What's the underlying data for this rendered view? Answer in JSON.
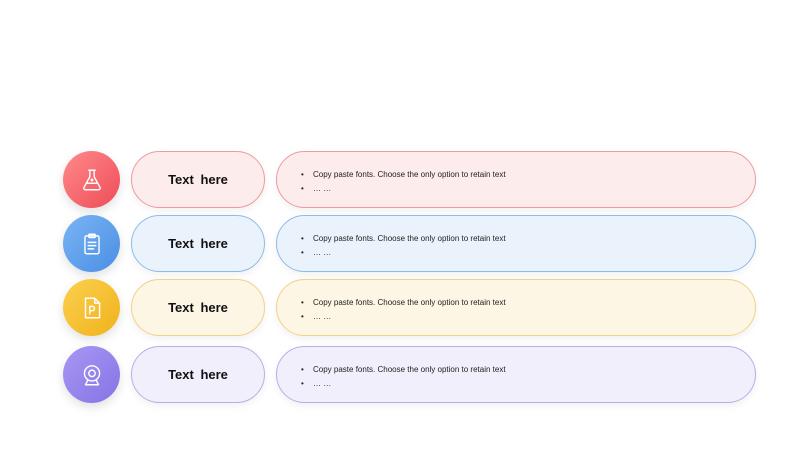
{
  "rows": [
    {
      "icon": "flask-icon",
      "title": "Text  here",
      "bullets": [
        "Copy paste fonts. Choose the only option to retain text",
        "… …"
      ],
      "colors": {
        "circle_from": "#ff8a8a",
        "circle_to": "#ee4c58",
        "pill_bg": "#fdecec",
        "pill_border": "#ee9aa0"
      }
    },
    {
      "icon": "clipboard-icon",
      "title": "Text  here",
      "bullets": [
        "Copy paste fonts. Choose the only option to retain text",
        "… …"
      ],
      "colors": {
        "circle_from": "#7ab4f4",
        "circle_to": "#4a8fe4",
        "pill_bg": "#eaf3fc",
        "pill_border": "#8ebbe8"
      }
    },
    {
      "icon": "presentation-file-icon",
      "title": "Text  here",
      "bullets": [
        "Copy paste fonts. Choose the only option to retain text",
        "… …"
      ],
      "colors": {
        "circle_from": "#fcd04e",
        "circle_to": "#f0b21c",
        "pill_bg": "#fdf6e4",
        "pill_border": "#f1d28a"
      }
    },
    {
      "icon": "webcam-icon",
      "title": "Text  here",
      "bullets": [
        "Copy paste fonts. Choose the only option to retain text",
        "… …"
      ],
      "colors": {
        "circle_from": "#a997f4",
        "circle_to": "#8574e4",
        "pill_bg": "#f1effc",
        "pill_border": "#b8aee8"
      }
    }
  ]
}
